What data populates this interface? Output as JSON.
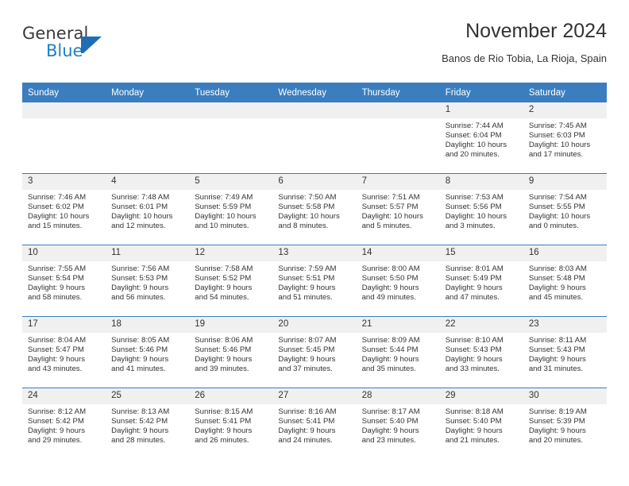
{
  "brand": {
    "name_line1": "General",
    "name_line2": "Blue",
    "flag_icon": "blue-flag-triangle",
    "accent_color": "#1f7fc4"
  },
  "header": {
    "title": "November 2024",
    "location": "Banos de Rio Tobia, La Rioja, Spain"
  },
  "theme": {
    "header_blue": "#3a7ebf",
    "daynum_gray": "#f0f0f0",
    "text": "#333333"
  },
  "weekday_headers": [
    "Sunday",
    "Monday",
    "Tuesday",
    "Wednesday",
    "Thursday",
    "Friday",
    "Saturday"
  ],
  "weeks": [
    [
      {
        "day": "",
        "empty": true,
        "lines": []
      },
      {
        "day": "",
        "empty": true,
        "lines": []
      },
      {
        "day": "",
        "empty": true,
        "lines": []
      },
      {
        "day": "",
        "empty": true,
        "lines": []
      },
      {
        "day": "",
        "empty": true,
        "lines": []
      },
      {
        "day": "1",
        "empty": false,
        "lines": [
          "Sunrise: 7:44 AM",
          "Sunset: 6:04 PM",
          "Daylight: 10 hours",
          "and 20 minutes."
        ]
      },
      {
        "day": "2",
        "empty": false,
        "lines": [
          "Sunrise: 7:45 AM",
          "Sunset: 6:03 PM",
          "Daylight: 10 hours",
          "and 17 minutes."
        ]
      }
    ],
    [
      {
        "day": "3",
        "empty": false,
        "lines": [
          "Sunrise: 7:46 AM",
          "Sunset: 6:02 PM",
          "Daylight: 10 hours",
          "and 15 minutes."
        ]
      },
      {
        "day": "4",
        "empty": false,
        "lines": [
          "Sunrise: 7:48 AM",
          "Sunset: 6:01 PM",
          "Daylight: 10 hours",
          "and 12 minutes."
        ]
      },
      {
        "day": "5",
        "empty": false,
        "lines": [
          "Sunrise: 7:49 AM",
          "Sunset: 5:59 PM",
          "Daylight: 10 hours",
          "and 10 minutes."
        ]
      },
      {
        "day": "6",
        "empty": false,
        "lines": [
          "Sunrise: 7:50 AM",
          "Sunset: 5:58 PM",
          "Daylight: 10 hours",
          "and 8 minutes."
        ]
      },
      {
        "day": "7",
        "empty": false,
        "lines": [
          "Sunrise: 7:51 AM",
          "Sunset: 5:57 PM",
          "Daylight: 10 hours",
          "and 5 minutes."
        ]
      },
      {
        "day": "8",
        "empty": false,
        "lines": [
          "Sunrise: 7:53 AM",
          "Sunset: 5:56 PM",
          "Daylight: 10 hours",
          "and 3 minutes."
        ]
      },
      {
        "day": "9",
        "empty": false,
        "lines": [
          "Sunrise: 7:54 AM",
          "Sunset: 5:55 PM",
          "Daylight: 10 hours",
          "and 0 minutes."
        ]
      }
    ],
    [
      {
        "day": "10",
        "empty": false,
        "lines": [
          "Sunrise: 7:55 AM",
          "Sunset: 5:54 PM",
          "Daylight: 9 hours",
          "and 58 minutes."
        ]
      },
      {
        "day": "11",
        "empty": false,
        "lines": [
          "Sunrise: 7:56 AM",
          "Sunset: 5:53 PM",
          "Daylight: 9 hours",
          "and 56 minutes."
        ]
      },
      {
        "day": "12",
        "empty": false,
        "lines": [
          "Sunrise: 7:58 AM",
          "Sunset: 5:52 PM",
          "Daylight: 9 hours",
          "and 54 minutes."
        ]
      },
      {
        "day": "13",
        "empty": false,
        "lines": [
          "Sunrise: 7:59 AM",
          "Sunset: 5:51 PM",
          "Daylight: 9 hours",
          "and 51 minutes."
        ]
      },
      {
        "day": "14",
        "empty": false,
        "lines": [
          "Sunrise: 8:00 AM",
          "Sunset: 5:50 PM",
          "Daylight: 9 hours",
          "and 49 minutes."
        ]
      },
      {
        "day": "15",
        "empty": false,
        "lines": [
          "Sunrise: 8:01 AM",
          "Sunset: 5:49 PM",
          "Daylight: 9 hours",
          "and 47 minutes."
        ]
      },
      {
        "day": "16",
        "empty": false,
        "lines": [
          "Sunrise: 8:03 AM",
          "Sunset: 5:48 PM",
          "Daylight: 9 hours",
          "and 45 minutes."
        ]
      }
    ],
    [
      {
        "day": "17",
        "empty": false,
        "lines": [
          "Sunrise: 8:04 AM",
          "Sunset: 5:47 PM",
          "Daylight: 9 hours",
          "and 43 minutes."
        ]
      },
      {
        "day": "18",
        "empty": false,
        "lines": [
          "Sunrise: 8:05 AM",
          "Sunset: 5:46 PM",
          "Daylight: 9 hours",
          "and 41 minutes."
        ]
      },
      {
        "day": "19",
        "empty": false,
        "lines": [
          "Sunrise: 8:06 AM",
          "Sunset: 5:46 PM",
          "Daylight: 9 hours",
          "and 39 minutes."
        ]
      },
      {
        "day": "20",
        "empty": false,
        "lines": [
          "Sunrise: 8:07 AM",
          "Sunset: 5:45 PM",
          "Daylight: 9 hours",
          "and 37 minutes."
        ]
      },
      {
        "day": "21",
        "empty": false,
        "lines": [
          "Sunrise: 8:09 AM",
          "Sunset: 5:44 PM",
          "Daylight: 9 hours",
          "and 35 minutes."
        ]
      },
      {
        "day": "22",
        "empty": false,
        "lines": [
          "Sunrise: 8:10 AM",
          "Sunset: 5:43 PM",
          "Daylight: 9 hours",
          "and 33 minutes."
        ]
      },
      {
        "day": "23",
        "empty": false,
        "lines": [
          "Sunrise: 8:11 AM",
          "Sunset: 5:43 PM",
          "Daylight: 9 hours",
          "and 31 minutes."
        ]
      }
    ],
    [
      {
        "day": "24",
        "empty": false,
        "lines": [
          "Sunrise: 8:12 AM",
          "Sunset: 5:42 PM",
          "Daylight: 9 hours",
          "and 29 minutes."
        ]
      },
      {
        "day": "25",
        "empty": false,
        "lines": [
          "Sunrise: 8:13 AM",
          "Sunset: 5:42 PM",
          "Daylight: 9 hours",
          "and 28 minutes."
        ]
      },
      {
        "day": "26",
        "empty": false,
        "lines": [
          "Sunrise: 8:15 AM",
          "Sunset: 5:41 PM",
          "Daylight: 9 hours",
          "and 26 minutes."
        ]
      },
      {
        "day": "27",
        "empty": false,
        "lines": [
          "Sunrise: 8:16 AM",
          "Sunset: 5:41 PM",
          "Daylight: 9 hours",
          "and 24 minutes."
        ]
      },
      {
        "day": "28",
        "empty": false,
        "lines": [
          "Sunrise: 8:17 AM",
          "Sunset: 5:40 PM",
          "Daylight: 9 hours",
          "and 23 minutes."
        ]
      },
      {
        "day": "29",
        "empty": false,
        "lines": [
          "Sunrise: 8:18 AM",
          "Sunset: 5:40 PM",
          "Daylight: 9 hours",
          "and 21 minutes."
        ]
      },
      {
        "day": "30",
        "empty": false,
        "lines": [
          "Sunrise: 8:19 AM",
          "Sunset: 5:39 PM",
          "Daylight: 9 hours",
          "and 20 minutes."
        ]
      }
    ]
  ]
}
